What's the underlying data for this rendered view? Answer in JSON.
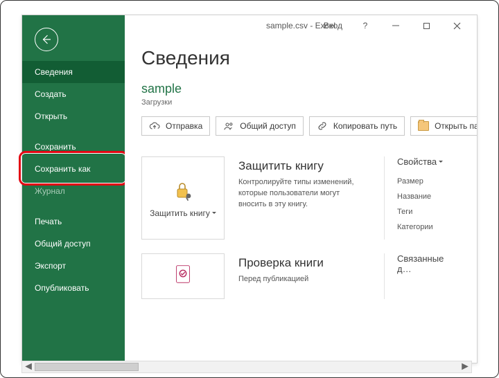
{
  "window": {
    "title": "sample.csv  -  Excel",
    "sign_in": "Вход",
    "help": "?",
    "minimize": "–",
    "maximize": "□",
    "close": "✕"
  },
  "back_icon": "←",
  "menu": {
    "items": [
      {
        "label": "Сведения",
        "selected": true
      },
      {
        "label": "Создать"
      },
      {
        "label": "Открыть"
      },
      {
        "label": "Сохранить"
      },
      {
        "label": "Сохранить как",
        "highlight": true
      },
      {
        "label": "Журнал",
        "disabled": true
      },
      {
        "label": "Печать"
      },
      {
        "label": "Общий доступ"
      },
      {
        "label": "Экспорт"
      },
      {
        "label": "Опубликовать"
      }
    ]
  },
  "page": {
    "title": "Сведения",
    "doc_name": "sample",
    "doc_path": "Загрузки"
  },
  "actions": {
    "upload": "Отправка",
    "share": "Общий доступ",
    "copy_path": "Копировать путь",
    "open_folder": "Открыть папку"
  },
  "protect": {
    "tile_label": "Защитить книгу",
    "heading": "Защитить книгу",
    "body": "Контролируйте типы изменений, которые пользователи могут вносить в эту книгу."
  },
  "inspect": {
    "heading": "Проверка книги",
    "body": "Перед публикацией"
  },
  "properties": {
    "title": "Свойства",
    "size": "Размер",
    "name": "Название",
    "tags": "Теги",
    "categories": "Категории"
  },
  "related": {
    "title": "Связанные д…"
  },
  "scroll": {
    "left": "◄",
    "right": "►"
  }
}
